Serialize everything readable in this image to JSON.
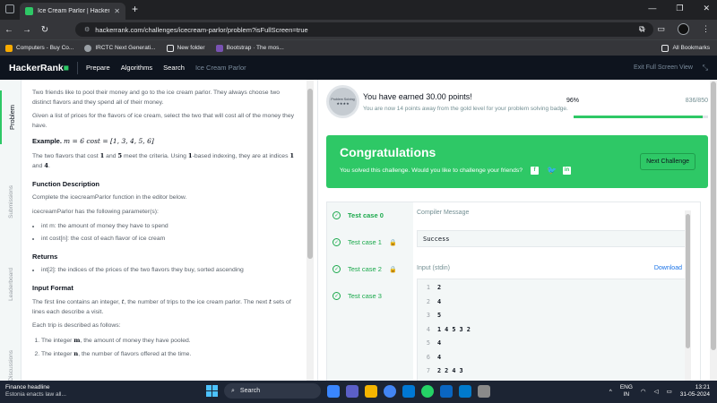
{
  "browser": {
    "tab_title": "Ice Cream Parlor | HackerRank",
    "url": "hackerrank.com/challenges/icecream-parlor/problem?isFullScreen=true",
    "bookmarks": [
      {
        "label": "Computers - Buy Co...",
        "color": "#f9ab00"
      },
      {
        "label": "IRCTC Next Generati...",
        "color": "#9aa0a6"
      },
      {
        "label": "New folder",
        "color": "#e8eaed"
      },
      {
        "label": "Bootstrap · The mos...",
        "color": "#7952b3"
      }
    ],
    "all_bookmarks": "All Bookmarks"
  },
  "header": {
    "logo_text": "HackerRank",
    "logo_pipe": "|",
    "nav": [
      "Prepare",
      "Algorithms",
      "Search"
    ],
    "crumb": "Ice Cream Parlor",
    "exit_label": "Exit Full Screen View"
  },
  "side_tabs": [
    "Problem",
    "Submissions",
    "Leaderboard",
    "Discussions"
  ],
  "problem": {
    "p1": "Two friends like to pool their money and go to the ice cream parlor. They always choose two distinct flavors and they spend all of their money.",
    "p2": "Given a list of prices for the flavors of ice cream, select the two that will cost all of the money they have.",
    "example_label": "Example.",
    "example_expr": "m = 6 cost = [1, 3, 4, 5, 6]",
    "p3a": "The two flavors that cost ",
    "p3b": "1",
    "p3c": " and ",
    "p3d": "5",
    "p3e": " meet the criteria. Using ",
    "p3f": "1",
    "p3g": "-based indexing, they are at indices ",
    "p3h": "1",
    "p3i": " and ",
    "p3j": "4",
    "p3k": ".",
    "h_function": "Function Description",
    "p4": "Complete the icecreamParlor function in the editor below.",
    "p5": "icecreamParlor has the following parameter(s):",
    "params": [
      "int m: the amount of money they have to spend",
      "int cost[n]: the cost of each flavor of ice cream"
    ],
    "h_returns": "Returns",
    "returns": [
      "int[2]: the indices of the prices of the two flavors they buy, sorted ascending"
    ],
    "h_input": "Input Format",
    "p6a": "The first line contains an integer, ",
    "p6b": "t",
    "p6c": ", the number of trips to the ice cream parlor. The next ",
    "p6d": "t",
    "p6e": " sets of lines each describe a visit.",
    "p7": "Each trip is described as follows:",
    "trip_items": [
      {
        "a": "The integer ",
        "v": "m",
        "b": ", the amount of money they have pooled."
      },
      {
        "a": "The integer ",
        "v": "n",
        "b": ", the number of flavors offered at the time."
      }
    ]
  },
  "score": {
    "badge_name": "Problem Solving",
    "badge_stars": "★★★★",
    "earned": "You have earned 30.00 points!",
    "gold_msg": "You are now 14 points away from the gold level for your problem solving badge.",
    "percent_label": "96%",
    "progress": 0.96,
    "rank": "836/850"
  },
  "congrats": {
    "title": "Congratulations",
    "subtitle": "You solved this challenge. Would you like to challenge your friends?",
    "next_label": "Next Challenge"
  },
  "test_cases": [
    {
      "label": "Test case 0",
      "locked": false,
      "active": true
    },
    {
      "label": "Test case 1",
      "locked": true,
      "active": false
    },
    {
      "label": "Test case 2",
      "locked": true,
      "active": false
    },
    {
      "label": "Test case 3",
      "locked": false,
      "active": false
    }
  ],
  "result": {
    "compiler_label": "Compiler Message",
    "compiler_message": "Success",
    "input_label": "Input (stdin)",
    "download_label": "Download",
    "stdin_lines": [
      "2",
      "4",
      "5",
      "1 4 5 3 2",
      "4",
      "4",
      "2 2 4 3"
    ]
  },
  "taskbar": {
    "news_title": "Finance headline",
    "news_sub": "Estonia enacts law all...",
    "search_placeholder": "Search",
    "lang_top": "ENG",
    "lang_bottom": "IN",
    "time": "13:21",
    "date": "31-05-2024"
  }
}
